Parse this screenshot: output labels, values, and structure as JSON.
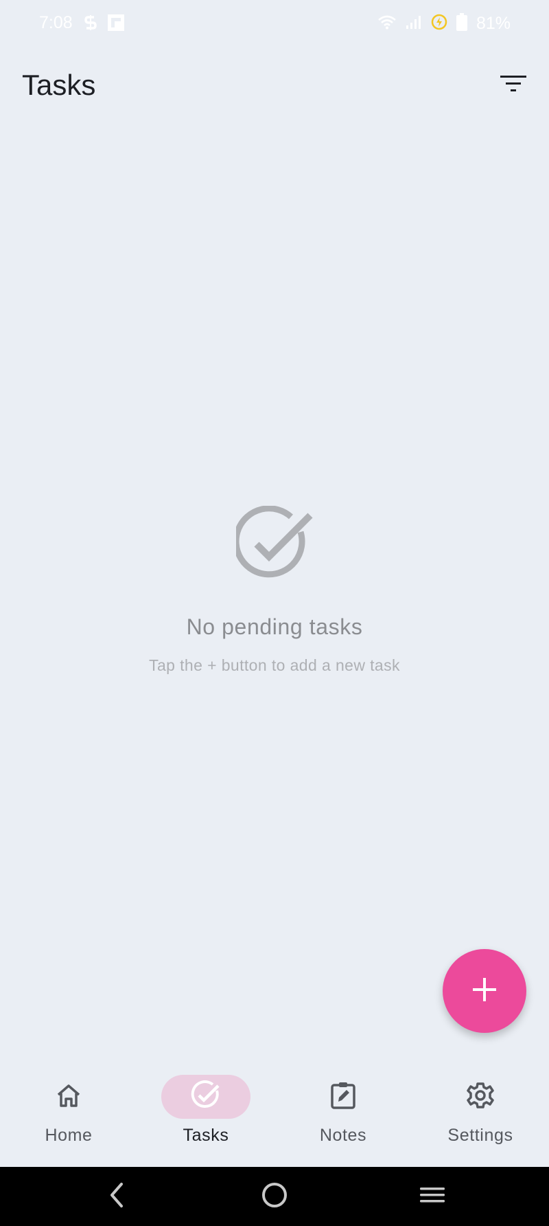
{
  "status_bar": {
    "time": "7:08",
    "battery": "81%",
    "left_icons": [
      "s-notification-icon",
      "flipboard-icon"
    ],
    "right_icons": [
      "wifi-icon",
      "signal-icon",
      "battery-saver-icon",
      "battery-icon"
    ]
  },
  "app_bar": {
    "title": "Tasks",
    "filter_icon": "filter-list-icon"
  },
  "empty_state": {
    "icon": "check-circle-icon",
    "title": "No pending tasks",
    "subtitle": "Tap the + button to add a new task"
  },
  "fab": {
    "icon": "plus-icon",
    "color": "#ec4a9b"
  },
  "bottom_nav": {
    "items": [
      {
        "label": "Home",
        "icon": "home-icon",
        "active": false
      },
      {
        "label": "Tasks",
        "icon": "check-circle-icon",
        "active": true
      },
      {
        "label": "Notes",
        "icon": "edit-note-icon",
        "active": false
      },
      {
        "label": "Settings",
        "icon": "gear-icon",
        "active": false
      }
    ],
    "active_indicator_color": "#ebcde0"
  },
  "system_nav": {
    "buttons": [
      "back-icon",
      "home-circle-icon",
      "recents-icon"
    ]
  }
}
